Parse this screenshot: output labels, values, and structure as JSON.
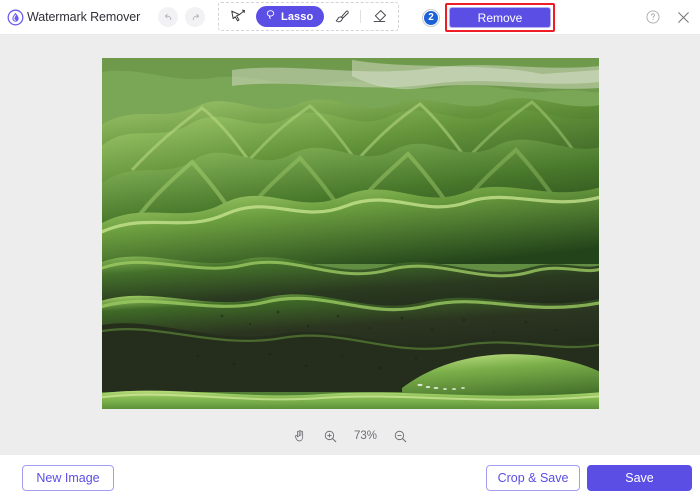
{
  "app": {
    "title": "Watermark Remover",
    "logo_icon": "water-drop-logo-icon",
    "accent_color": "#5b4ee5",
    "highlight_color": "#ee1c25",
    "badge_color": "#1c60d8"
  },
  "header": {
    "history": {
      "undo_icon": "undo-arrow-icon",
      "redo_icon": "redo-arrow-icon"
    },
    "tools": [
      {
        "name": "lasso-select-tool",
        "icon": "lasso-cursor-icon",
        "label": "",
        "active": false
      },
      {
        "name": "lasso-tool",
        "icon": "lasso-loop-icon",
        "label": "Lasso",
        "active": true
      },
      {
        "name": "brush-tool",
        "icon": "paint-brush-icon",
        "label": "",
        "active": false
      },
      {
        "name": "eraser-tool",
        "icon": "eraser-icon",
        "label": "",
        "active": false
      }
    ],
    "step_badge": "2",
    "remove_label": "Remove",
    "help_icon": "question-circle-icon",
    "close_icon": "close-x-icon"
  },
  "canvas": {
    "image_alt": "green rolling hills landscape",
    "zoom": {
      "pan_icon": "hand-pan-icon",
      "zoom_in_icon": "zoom-in-icon",
      "level": "73%",
      "zoom_out_icon": "zoom-out-icon"
    }
  },
  "footer": {
    "new_image_label": "New Image",
    "crop_save_label": "Crop & Save",
    "save_label": "Save"
  }
}
